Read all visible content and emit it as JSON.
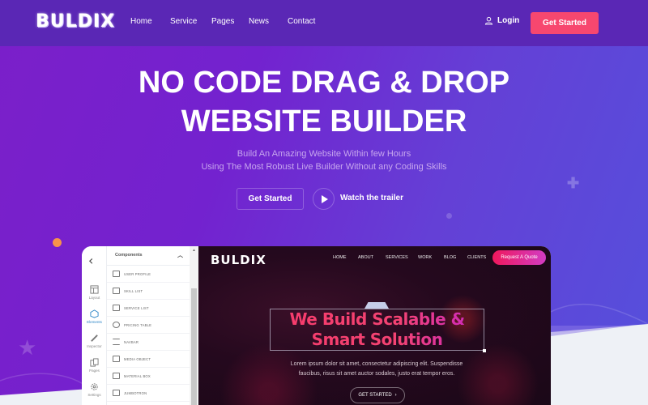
{
  "header": {
    "logo": "BULDIX",
    "nav": [
      "Home",
      "Service",
      "Pages",
      "News",
      "Contact"
    ],
    "login_label": "Login",
    "login_icon": "user-icon",
    "cta_label": "Get Started"
  },
  "hero": {
    "title_line1": "NO CODE DRAG & DROP",
    "title_line2": "WEBSITE BUILDER",
    "subtitle_line1": "Build An Amazing Website Within few Hours",
    "subtitle_line2": "Using The Most Robust Live Builder Without any Coding Skills",
    "primary_button": "Get Started",
    "play_icon": "play-icon",
    "trailer_label": "Watch the trailer"
  },
  "builder": {
    "rail": {
      "back_icon": "chevron-left-icon",
      "items": [
        {
          "label": "Layout",
          "icon": "layout-icon"
        },
        {
          "label": "Elements",
          "icon": "elements-icon",
          "active": true
        },
        {
          "label": "Inspector",
          "icon": "pencil-icon"
        },
        {
          "label": "Pages",
          "icon": "pages-icon"
        },
        {
          "label": "Settings",
          "icon": "gear-icon"
        }
      ]
    },
    "panel": {
      "title": "Components",
      "components": [
        "USER PROFILE",
        "SKILL LIST",
        "SERVICE LIST",
        "PRICING TABLE",
        "NAVBAR",
        "MEDIA OBJECT",
        "MATERIAL BOX",
        "JUMBOTRON"
      ]
    },
    "canvas": {
      "logo": "BULDIX",
      "nav": [
        "HOME",
        "ABOUT",
        "SERVICES",
        "WORK",
        "BLOG",
        "CLIENTS"
      ],
      "quote_button": "Request A Quote",
      "headline_line1": "We Build Scalable &",
      "headline_line2": "Smart Solution",
      "body_line1": "Lorem ipsum dolor sit amet, consectetur adipiscing elit. Suspendisse",
      "body_line2": "faucibus, risus sit amet auctor sodales, justo erat tempor eros.",
      "button": "GET STARTED"
    }
  },
  "colors": {
    "header_bg": "#5a27b5",
    "accent": "#f7476f",
    "hero_gradient_start": "#7b1fc9",
    "hero_gradient_end": "#5550dc",
    "orange_dot": "#f7934a",
    "active_rail": "#2b84c6"
  }
}
